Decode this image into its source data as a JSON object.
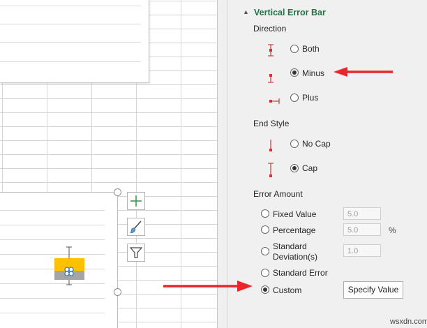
{
  "panel": {
    "section_title": "Vertical Error Bar",
    "collapse_glyph": "▲",
    "direction_label": "Direction",
    "direction_options": [
      {
        "label": "Both",
        "selected": false,
        "icon": "error-bar-both-icon"
      },
      {
        "label": "Minus",
        "selected": true,
        "icon": "error-bar-minus-icon"
      },
      {
        "label": "Plus",
        "selected": false,
        "icon": "error-bar-plus-icon"
      }
    ],
    "end_style_label": "End Style",
    "end_style_options": [
      {
        "label": "No Cap",
        "selected": false,
        "icon": "no-cap-icon"
      },
      {
        "label": "Cap",
        "selected": true,
        "icon": "cap-icon"
      }
    ],
    "error_amount_label": "Error Amount",
    "error_amount_options": [
      {
        "label": "Fixed Value",
        "selected": false,
        "value": "5.0"
      },
      {
        "label": "Percentage",
        "selected": false,
        "value": "5.0",
        "unit": "%"
      },
      {
        "label_line1": "Standard",
        "label_line2": "Deviation(s)",
        "selected": false,
        "value": "1.0"
      },
      {
        "label": "Standard Error",
        "selected": false
      },
      {
        "label": "Custom",
        "selected": true
      }
    ],
    "specify_value_button": "Specify Value"
  },
  "chart_tools": {
    "elements_icon": "plus-icon",
    "styles_icon": "paintbrush-icon",
    "filter_icon": "funnel-icon"
  },
  "watermark": "wsxdn.com",
  "colors": {
    "accent_green": "#217346",
    "arrow_red": "#e8262b",
    "bar_yellow": "#ffc000",
    "bar_gray": "#a5a5a5",
    "icon_red": "#d13438"
  }
}
